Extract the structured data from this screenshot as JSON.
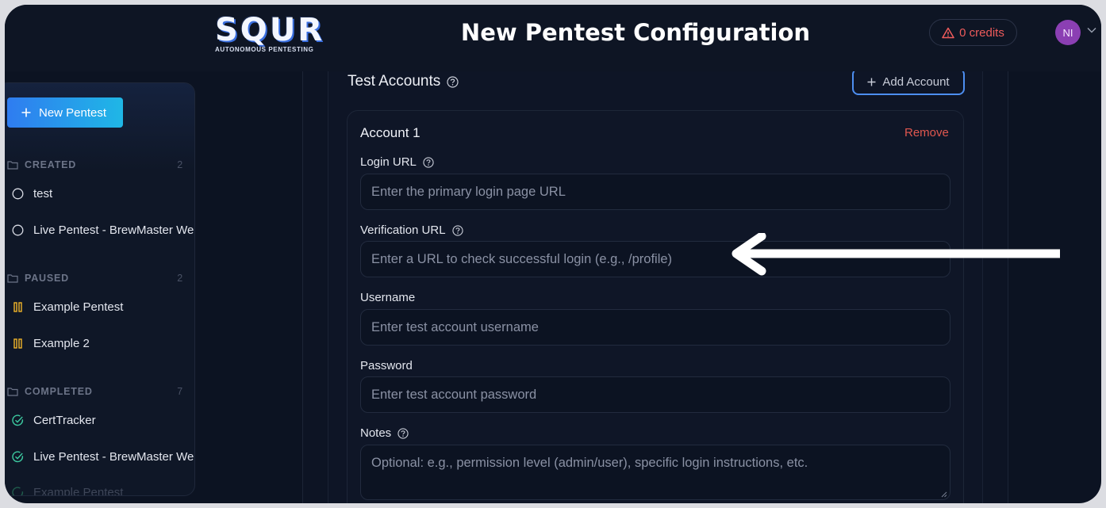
{
  "header": {
    "logo_main": "SQUR",
    "logo_sub": "AUTONOMOUS PENTESTING",
    "title": "New Pentest Configuration",
    "credits_label": "0 credits",
    "avatar_initials": "NI"
  },
  "sidebar": {
    "new_button_label": "New Pentest",
    "groups": [
      {
        "name": "CREATED",
        "count": "2",
        "items": [
          {
            "label": "test",
            "status": "created"
          },
          {
            "label": "Live Pentest - BrewMaster We",
            "status": "created"
          }
        ]
      },
      {
        "name": "PAUSED",
        "count": "2",
        "items": [
          {
            "label": "Example Pentest",
            "status": "paused"
          },
          {
            "label": "Example 2",
            "status": "paused"
          }
        ]
      },
      {
        "name": "COMPLETED",
        "count": "7",
        "items": [
          {
            "label": "CertTracker",
            "status": "completed"
          },
          {
            "label": "Live Pentest - BrewMaster We",
            "status": "completed"
          },
          {
            "label": "Example Pentest",
            "status": "completed"
          }
        ]
      }
    ]
  },
  "main": {
    "section_title": "Test Accounts",
    "add_account_label": "Add Account",
    "account": {
      "title": "Account 1",
      "remove_label": "Remove",
      "fields": {
        "login_url": {
          "label": "Login URL",
          "placeholder": "Enter the primary login page URL"
        },
        "verification_url": {
          "label": "Verification URL",
          "placeholder": "Enter a URL to check successful login (e.g., /profile)"
        },
        "username": {
          "label": "Username",
          "placeholder": "Enter test account username"
        },
        "password": {
          "label": "Password",
          "placeholder": "Enter test account password"
        },
        "notes": {
          "label": "Notes",
          "placeholder": "Optional: e.g., permission level (admin/user), specific login instructions, etc."
        }
      }
    }
  },
  "colors": {
    "accent": "#2f7cf0",
    "danger": "#e0574f",
    "paused": "#f0b429",
    "completed": "#3cc9a0",
    "avatar": "#8b3fb3"
  },
  "icons": {
    "help": "question-circle-icon",
    "alert": "warning-triangle-icon",
    "folder": "folder-icon",
    "created": "circle-outline-icon",
    "paused": "pause-icon",
    "completed": "check-circle-icon",
    "annotation": "arrow-left-icon"
  }
}
